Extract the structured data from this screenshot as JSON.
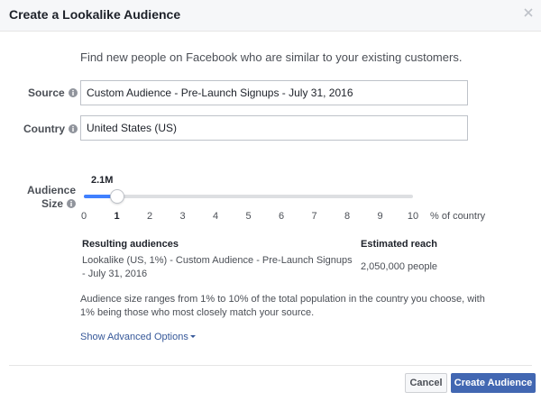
{
  "dialog": {
    "title": "Create a Lookalike Audience",
    "intro": "Find new people on Facebook who are similar to your existing customers."
  },
  "source": {
    "label": "Source",
    "value": "Custom Audience - Pre-Launch Signups - July 31, 2016",
    "info_icon": "info-icon"
  },
  "country": {
    "label": "Country",
    "value": "United States (US)",
    "info_icon": "info-icon"
  },
  "audience_size": {
    "label_line1": "Audience",
    "label_line2": "Size",
    "selected_value_label": "2.1M",
    "selected_percent": 1,
    "min": 0,
    "max": 10,
    "ticks": [
      "0",
      "1",
      "2",
      "3",
      "4",
      "5",
      "6",
      "7",
      "8",
      "9",
      "10"
    ],
    "unit_label": "% of country"
  },
  "results": {
    "col_audiences": "Resulting audiences",
    "col_reach": "Estimated reach",
    "audience_name": "Lookalike (US, 1%) - Custom Audience - Pre-Launch Signups - July 31, 2016",
    "reach_value": "2,050,000 people"
  },
  "note": "Audience size ranges from 1% to 10% of the total population in the country you choose, with 1% being those who most closely match your source.",
  "advanced_link": "Show Advanced Options",
  "footer": {
    "cancel_label": "Cancel",
    "create_label": "Create Audience"
  },
  "colors": {
    "accent": "#4080ff",
    "primary_button": "#4267b2",
    "link": "#365899"
  }
}
